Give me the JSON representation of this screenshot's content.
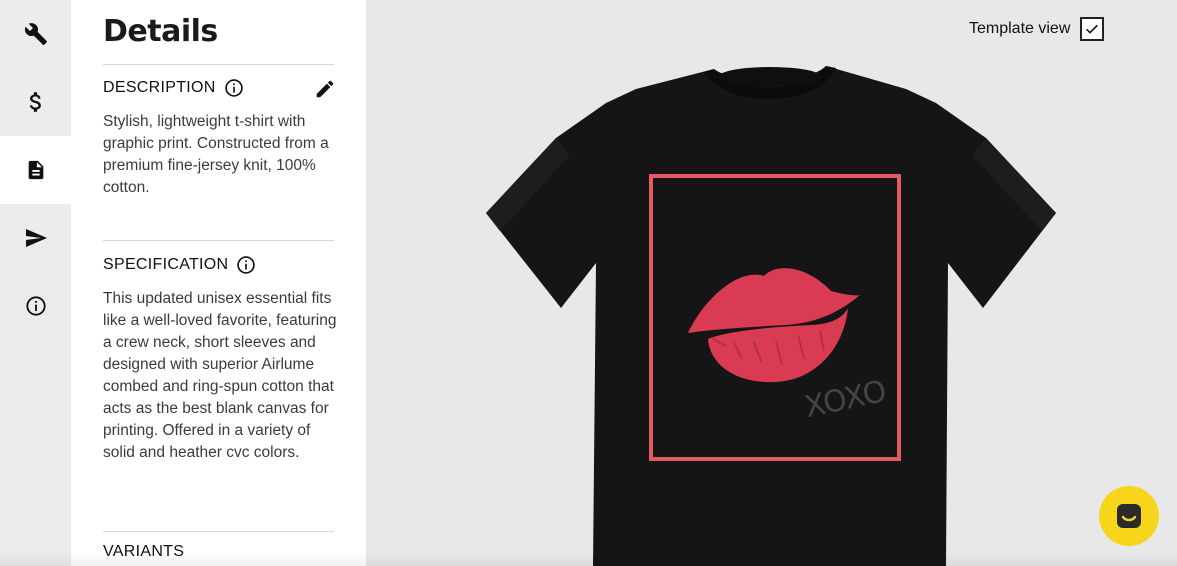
{
  "panel": {
    "title": "Details",
    "description": {
      "heading": "DESCRIPTION",
      "text": "Stylish, lightweight t-shirt with graphic print. Constructed from a premium fine-jersey knit, 100% cotton."
    },
    "specification": {
      "heading": "SPECIFICATION",
      "text": "This updated unisex essential fits like a well-loved favorite, featuring a crew neck, short sleeves and designed with superior Airlume combed and ring-spun cotton that acts as the best blank canvas for printing. Offered in a variety of solid and heather cvc colors."
    },
    "variants": {
      "heading": "VARIANTS"
    }
  },
  "sidebar": {
    "items": [
      {
        "icon": "wrench-icon",
        "active": false
      },
      {
        "icon": "dollar-icon",
        "active": false
      },
      {
        "icon": "document-icon",
        "active": true
      },
      {
        "icon": "send-icon",
        "active": false
      },
      {
        "icon": "info-icon",
        "active": false
      }
    ]
  },
  "canvas": {
    "template_view_label": "Template view",
    "template_view_checked": true,
    "product": {
      "shirt_color": "#151515",
      "frame_color": "#e55a63",
      "lips_color": "#d93b52",
      "print_text": "XOXO"
    }
  },
  "chat": {
    "icon": "chat-icon",
    "color": "#f7d51b"
  }
}
